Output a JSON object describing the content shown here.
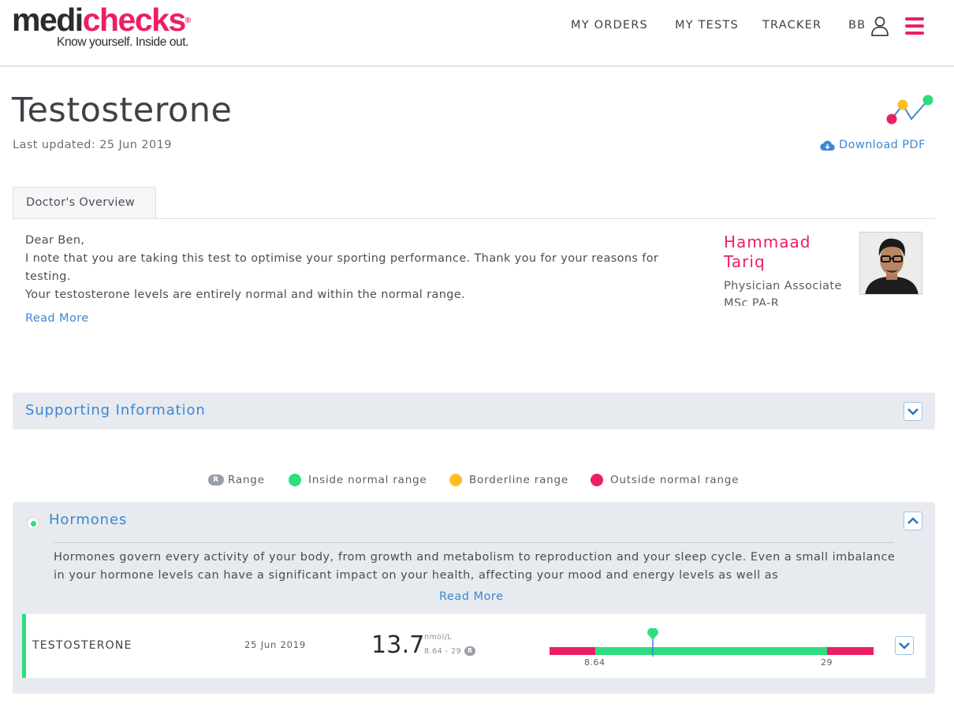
{
  "brand": {
    "name_part1": "medi",
    "name_part2": "checks",
    "registered": "®",
    "tagline": "Know yourself. Inside out.",
    "accent_color": "#ec1f64"
  },
  "nav": {
    "orders": "MY ORDERS",
    "tests": "MY TESTS",
    "tracker": "TRACKER",
    "user_initials": "BB"
  },
  "page": {
    "title": "Testosterone",
    "last_updated": "Last updated: 25 Jun 2019",
    "download_label": "Download PDF"
  },
  "tabs": [
    {
      "label": "Doctor's Overview",
      "active": true
    }
  ],
  "overview": {
    "greeting": "Dear Ben,",
    "paragraph1": "I note that you are taking this test to optimise your sporting performance. Thank you for your reasons for testing.",
    "paragraph2": "Your testosterone levels are entirely normal and within the normal range.",
    "read_more": "Read More",
    "doctor": {
      "name": "Hammaad Tariq",
      "role": "Physician Associate",
      "credentials": "MSc PA-R"
    }
  },
  "supporting": {
    "title": "Supporting Information"
  },
  "legend": {
    "range_badge": "R",
    "range": "Range",
    "inside": "Inside normal range",
    "borderline": "Borderline range",
    "outside": "Outside normal range",
    "colors": {
      "inside": "#2dde7f",
      "borderline": "#fbbf24",
      "outside": "#ec1f64"
    }
  },
  "hormones": {
    "title": "Hormones",
    "description": "Hormones govern every activity of your body, from growth and metabolism to reproduction and your sleep cycle. Even a small imbalance in your hormone levels can have a significant impact on your health, affecting your mood and energy levels as well as",
    "read_more": "Read More",
    "results": [
      {
        "name": "TESTOSTERONE",
        "date": "25 Jun 2019",
        "value": "13.7",
        "unit": "nmol/L",
        "range_text": "8.64 - 29",
        "range_badge": "R",
        "low": "8.64",
        "high": "29"
      }
    ]
  }
}
